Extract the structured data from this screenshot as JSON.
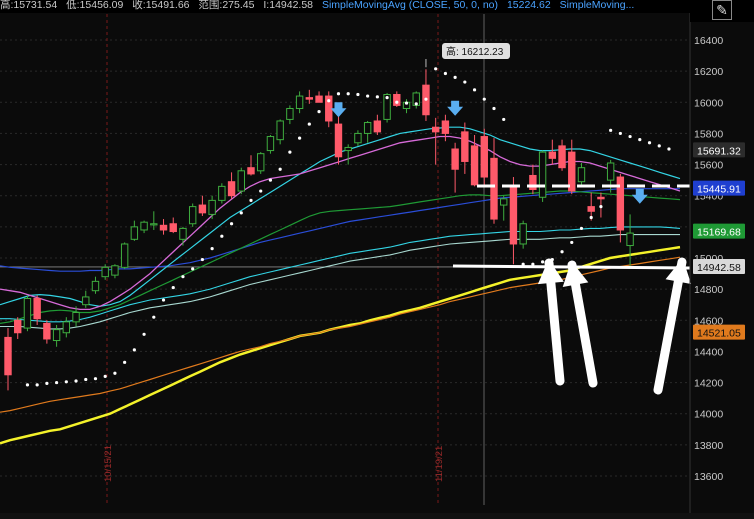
{
  "header": {
    "open_text": "高:15731.54",
    "low_text": "低:15456.09",
    "close_text": "收:15491.66",
    "range_text": "范围:275.45",
    "last_text": "I:14942.58",
    "study1_text": "SimpleMovingAvg (CLOSE, 50, 0, no)",
    "study1_value": "15224.62",
    "study2_text": "SimpleMoving..."
  },
  "icons": {
    "draw": "pencil-line-icon"
  },
  "colors": {
    "up": "#3fae3f",
    "down": "#ff5a6a",
    "sar": "#ffffff",
    "sma_yellow": "#f4f22a",
    "sma_orange": "#e07a1d",
    "sma_blue": "#2a4dd8",
    "sma_green": "#1f9a35",
    "sma_cyan": "#33d4e4",
    "sma_magenta": "#d66ad8",
    "sma_white_teal": "#a8d8d0"
  },
  "price_labels": [
    {
      "value": 15691.32,
      "text": "15691.32",
      "bg": "#2c2c2c",
      "fg": "#ffffff"
    },
    {
      "value": 15445.91,
      "text": "15445.91",
      "bg": "#1f3fd0",
      "fg": "#ffffff"
    },
    {
      "value": 15169.68,
      "text": "15169.68",
      "bg": "#1f9a35",
      "fg": "#ffffff"
    },
    {
      "value": 14942.58,
      "text": "14942.58",
      "bg": "#d9d9d9",
      "fg": "#111111"
    },
    {
      "value": 14521.05,
      "text": "14521.05",
      "bg": "#e07a1d",
      "fg": "#111111"
    }
  ],
  "annotations": {
    "high_label": "高: 16212.23",
    "date1": "10/15/21",
    "date2": "11/19/21"
  },
  "chart_data": {
    "type": "candlestick",
    "ylim": [
      13500,
      16500
    ],
    "yticks": [
      13600,
      13800,
      14000,
      14200,
      14400,
      14600,
      14800,
      15000,
      15200,
      15400,
      15600,
      15800,
      16000,
      16200,
      16400
    ],
    "ytick_labels": [
      "13600",
      "13800",
      "14000",
      "14200",
      "14400",
      "14600",
      "14800",
      "15000",
      "15200",
      "15400",
      "15600",
      "15800",
      "16000",
      "16200",
      "16400"
    ],
    "candles": [
      [
        14490,
        14550,
        14150,
        14250
      ],
      [
        14600,
        14620,
        14480,
        14520
      ],
      [
        14550,
        14760,
        14530,
        14740
      ],
      [
        14740,
        14760,
        14570,
        14610
      ],
      [
        14580,
        14600,
        14450,
        14480
      ],
      [
        14470,
        14570,
        14430,
        14540
      ],
      [
        14520,
        14620,
        14490,
        14590
      ],
      [
        14590,
        14690,
        14560,
        14650
      ],
      [
        14700,
        14790,
        14680,
        14750
      ],
      [
        14790,
        14880,
        14770,
        14850
      ],
      [
        14880,
        14960,
        14860,
        14940
      ],
      [
        14890,
        14960,
        14870,
        14950
      ],
      [
        14940,
        15100,
        14930,
        15090
      ],
      [
        15120,
        15240,
        15110,
        15200
      ],
      [
        15180,
        15240,
        15160,
        15230
      ],
      [
        15220,
        15300,
        15180,
        15220
      ],
      [
        15210,
        15250,
        15150,
        15180
      ],
      [
        15220,
        15260,
        15160,
        15170
      ],
      [
        15120,
        15200,
        15080,
        15190
      ],
      [
        15220,
        15350,
        15200,
        15330
      ],
      [
        15340,
        15400,
        15270,
        15290
      ],
      [
        15280,
        15400,
        15250,
        15370
      ],
      [
        15370,
        15480,
        15350,
        15460
      ],
      [
        15490,
        15550,
        15380,
        15400
      ],
      [
        15430,
        15580,
        15410,
        15560
      ],
      [
        15580,
        15660,
        15530,
        15540
      ],
      [
        15560,
        15680,
        15540,
        15670
      ],
      [
        15690,
        15790,
        15670,
        15780
      ],
      [
        15760,
        15890,
        15730,
        15880
      ],
      [
        15890,
        15980,
        15860,
        15960
      ],
      [
        15960,
        16070,
        15930,
        16040
      ],
      [
        16030,
        16080,
        15990,
        16020
      ],
      [
        16040,
        16070,
        16000,
        16000
      ],
      [
        16040,
        16070,
        15840,
        15880
      ],
      [
        15860,
        15920,
        15600,
        15650
      ],
      [
        15690,
        15730,
        15600,
        15710
      ],
      [
        15740,
        15820,
        15720,
        15800
      ],
      [
        15800,
        15880,
        15740,
        15870
      ],
      [
        15880,
        15920,
        15790,
        15810
      ],
      [
        15890,
        16060,
        15870,
        16050
      ],
      [
        16050,
        16070,
        15970,
        15980
      ],
      [
        15960,
        16020,
        15930,
        16000
      ],
      [
        15980,
        16070,
        15960,
        16060
      ],
      [
        16110,
        16212,
        15880,
        15920
      ],
      [
        15840,
        15900,
        15600,
        15810
      ],
      [
        15880,
        15920,
        15750,
        15800
      ],
      [
        15700,
        15740,
        15420,
        15570
      ],
      [
        15810,
        15870,
        15540,
        15620
      ],
      [
        15720,
        15790,
        15460,
        15470
      ],
      [
        15780,
        15830,
        15460,
        15520
      ],
      [
        15640,
        15770,
        15220,
        15250
      ],
      [
        15340,
        15400,
        15240,
        15380
      ],
      [
        15450,
        15520,
        14960,
        15090
      ],
      [
        15090,
        15240,
        15060,
        15220
      ],
      [
        15530,
        15600,
        15410,
        15440
      ],
      [
        15390,
        15690,
        15360,
        15680
      ],
      [
        15680,
        15760,
        15600,
        15640
      ],
      [
        15720,
        15760,
        15560,
        15580
      ],
      [
        15680,
        15760,
        15410,
        15430
      ],
      [
        15490,
        15610,
        15460,
        15580
      ],
      [
        15330,
        15420,
        15240,
        15300
      ],
      [
        15390,
        15420,
        15260,
        15380
      ],
      [
        15500,
        15630,
        15420,
        15610
      ],
      [
        15520,
        15540,
        15100,
        15180
      ],
      [
        15080,
        15280,
        14950,
        15160
      ]
    ],
    "sar_dots": [
      [
        2,
        14185
      ],
      [
        3,
        14185
      ],
      [
        4,
        14195
      ],
      [
        5,
        14200
      ],
      [
        6,
        14205
      ],
      [
        7,
        14210
      ],
      [
        8,
        14220
      ],
      [
        9,
        14225
      ],
      [
        10,
        14240
      ],
      [
        11,
        14260
      ],
      [
        12,
        14330
      ],
      [
        13,
        14410
      ],
      [
        14,
        14510
      ],
      [
        15,
        14620
      ],
      [
        16,
        14730
      ],
      [
        17,
        14810
      ],
      [
        18,
        14880
      ],
      [
        19,
        14930
      ],
      [
        20,
        14990
      ],
      [
        21,
        15060
      ],
      [
        22,
        15140
      ],
      [
        23,
        15220
      ],
      [
        24,
        15290
      ],
      [
        25,
        15370
      ],
      [
        26,
        15430
      ],
      [
        27,
        15500
      ],
      [
        28,
        15570
      ],
      [
        29,
        15680
      ],
      [
        30,
        15770
      ],
      [
        31,
        15860
      ],
      [
        32,
        15940
      ],
      [
        33,
        16010
      ],
      [
        34,
        16055
      ],
      [
        35,
        16055
      ],
      [
        36,
        16050
      ],
      [
        37,
        16040
      ],
      [
        38,
        16035
      ],
      [
        39,
        16030
      ],
      [
        40,
        16000
      ],
      [
        41,
        15995
      ],
      [
        42,
        15990
      ],
      [
        43,
        16020
      ],
      [
        44,
        16215
      ],
      [
        45,
        16185
      ],
      [
        46,
        16160
      ],
      [
        47,
        16130
      ],
      [
        48,
        16080
      ],
      [
        49,
        16020
      ],
      [
        50,
        15960
      ],
      [
        51,
        15890
      ],
      [
        53,
        14960
      ],
      [
        54,
        14960
      ],
      [
        55,
        14975
      ],
      [
        56,
        14990
      ],
      [
        57,
        15040
      ],
      [
        58,
        15100
      ],
      [
        59,
        15190
      ],
      [
        60,
        15260
      ],
      [
        61,
        15330
      ],
      [
        62,
        15820
      ],
      [
        63,
        15800
      ],
      [
        64,
        15780
      ],
      [
        65,
        15760
      ],
      [
        66,
        15740
      ],
      [
        67,
        15720
      ],
      [
        68,
        15700
      ]
    ],
    "sma_series": [
      {
        "key": "yellow",
        "values": [
          13810,
          13830,
          13845,
          13860,
          13875,
          13890,
          13900,
          13920,
          13940,
          13960,
          13980,
          14000,
          14030,
          14060,
          14090,
          14120,
          14150,
          14180,
          14210,
          14240,
          14270,
          14300,
          14330,
          14355,
          14380,
          14400,
          14420,
          14440,
          14460,
          14480,
          14500,
          14510,
          14520,
          14540,
          14555,
          14570,
          14580,
          14600,
          14615,
          14630,
          14650,
          14665,
          14680,
          14700,
          14720,
          14740,
          14760,
          14780,
          14800,
          14820,
          14840,
          14860,
          14870,
          14880,
          14890,
          14900,
          14910,
          14920,
          14940,
          14960,
          14980,
          15000,
          15010,
          15020,
          15030,
          15040,
          15050,
          15060,
          15070
        ]
      },
      {
        "key": "orange",
        "values": [
          14010,
          14020,
          14035,
          14050,
          14065,
          14080,
          14090,
          14100,
          14110,
          14120,
          14130,
          14145,
          14160,
          14180,
          14200,
          14220,
          14240,
          14260,
          14280,
          14300,
          14320,
          14340,
          14360,
          14380,
          14400,
          14415,
          14430,
          14450,
          14465,
          14480,
          14500,
          14510,
          14520,
          14540,
          14550,
          14560,
          14575,
          14590,
          14605,
          14620,
          14640,
          14655,
          14670,
          14685,
          14700,
          14720,
          14735,
          14750,
          14765,
          14780,
          14795,
          14810,
          14820,
          14830,
          14840,
          14850,
          14860,
          14875,
          14890,
          14905,
          14920,
          14935,
          14945,
          14955,
          14965,
          14975,
          14985,
          14995,
          15005
        ]
      },
      {
        "key": "white_teal",
        "values": [
          14560,
          14560,
          14560,
          14555,
          14550,
          14545,
          14545,
          14550,
          14560,
          14575,
          14590,
          14610,
          14630,
          14650,
          14665,
          14680,
          14690,
          14700,
          14710,
          14720,
          14735,
          14750,
          14770,
          14790,
          14810,
          14830,
          14845,
          14860,
          14875,
          14890,
          14905,
          14920,
          14935,
          14950,
          14965,
          14980,
          14990,
          15000,
          15010,
          15020,
          15035,
          15050,
          15060,
          15070,
          15080,
          15090,
          15095,
          15100,
          15105,
          15110,
          15115,
          15120,
          15120,
          15120,
          15120,
          15125,
          15130,
          15130,
          15135,
          15140,
          15140,
          15145,
          15150,
          15150,
          15150,
          15150,
          15150,
          15150,
          15150
        ]
      },
      {
        "key": "cyan_lower",
        "values": [
          14610,
          14610,
          14605,
          14600,
          14595,
          14590,
          14590,
          14595,
          14605,
          14620,
          14640,
          14660,
          14680,
          14700,
          14715,
          14730,
          14740,
          14750,
          14760,
          14770,
          14785,
          14800,
          14820,
          14840,
          14860,
          14880,
          14895,
          14910,
          14925,
          14940,
          14955,
          14970,
          14985,
          15000,
          15015,
          15030,
          15040,
          15050,
          15060,
          15070,
          15085,
          15100,
          15110,
          15120,
          15130,
          15140,
          15145,
          15150,
          15155,
          15160,
          15165,
          15170,
          15170,
          15170,
          15170,
          15175,
          15180,
          15180,
          15185,
          15190,
          15190,
          15195,
          15200,
          15200,
          15200,
          15200,
          15200,
          15195,
          15190
        ]
      },
      {
        "key": "blue",
        "values": [
          14950,
          14940,
          14935,
          14930,
          14925,
          14920,
          14915,
          14915,
          14915,
          14920,
          14920,
          14925,
          14930,
          14930,
          14935,
          14940,
          14945,
          14950,
          14960,
          14970,
          14985,
          15000,
          15020,
          15040,
          15060,
          15080,
          15100,
          15115,
          15130,
          15145,
          15160,
          15175,
          15190,
          15205,
          15220,
          15235,
          15245,
          15255,
          15265,
          15275,
          15285,
          15295,
          15305,
          15315,
          15325,
          15335,
          15345,
          15355,
          15365,
          15375,
          15385,
          15390,
          15395,
          15400,
          15405,
          15410,
          15415,
          15420,
          15425,
          15430,
          15435,
          15440,
          15445,
          15445,
          15445,
          15445,
          15445,
          15445,
          15445
        ]
      },
      {
        "key": "green",
        "values": [
          14580,
          14590,
          14610,
          14630,
          14650,
          14660,
          14665,
          14660,
          14650,
          14650,
          14660,
          14680,
          14700,
          14730,
          14760,
          14790,
          14820,
          14850,
          14880,
          14910,
          14940,
          14970,
          15000,
          15030,
          15060,
          15090,
          15120,
          15150,
          15180,
          15210,
          15240,
          15270,
          15290,
          15300,
          15305,
          15310,
          15315,
          15320,
          15325,
          15330,
          15340,
          15350,
          15360,
          15370,
          15380,
          15390,
          15400,
          15405,
          15405,
          15400,
          15400,
          15405,
          15410,
          15415,
          15420,
          15425,
          15430,
          15430,
          15425,
          15420,
          15415,
          15410,
          15405,
          15400,
          15395,
          15390,
          15385,
          15380,
          15375
        ]
      },
      {
        "key": "cyan_upper",
        "values": [
          14700,
          14720,
          14740,
          14760,
          14765,
          14760,
          14750,
          14740,
          14720,
          14700,
          14690,
          14700,
          14720,
          14760,
          14810,
          14860,
          14910,
          14960,
          15010,
          15060,
          15110,
          15160,
          15210,
          15260,
          15300,
          15340,
          15380,
          15420,
          15460,
          15500,
          15540,
          15580,
          15620,
          15650,
          15680,
          15700,
          15720,
          15740,
          15760,
          15780,
          15800,
          15810,
          15820,
          15830,
          15835,
          15840,
          15840,
          15830,
          15810,
          15790,
          15760,
          15740,
          15720,
          15700,
          15690,
          15690,
          15695,
          15700,
          15700,
          15690,
          15670,
          15650,
          15630,
          15610,
          15590,
          15570,
          15550,
          15530,
          15510
        ]
      },
      {
        "key": "magenta",
        "values": [
          14800,
          14790,
          14780,
          14760,
          14740,
          14720,
          14700,
          14680,
          14670,
          14670,
          14690,
          14720,
          14760,
          14800,
          14850,
          14900,
          14960,
          15020,
          15080,
          15140,
          15200,
          15260,
          15320,
          15370,
          15420,
          15460,
          15490,
          15510,
          15520,
          15530,
          15540,
          15560,
          15580,
          15600,
          15620,
          15640,
          15660,
          15680,
          15700,
          15720,
          15740,
          15750,
          15760,
          15770,
          15780,
          15780,
          15770,
          15750,
          15720,
          15690,
          15650,
          15620,
          15600,
          15590,
          15590,
          15600,
          15610,
          15620,
          15620,
          15610,
          15590,
          15570,
          15550,
          15530,
          15510,
          15490,
          15470,
          15450,
          15430
        ]
      }
    ]
  }
}
